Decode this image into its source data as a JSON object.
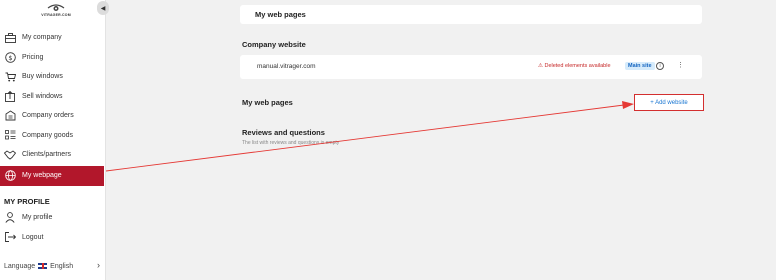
{
  "sidebar": {
    "logo_text": "VITRAGER.COM",
    "items": [
      {
        "label": "My company",
        "icon": "briefcase-icon"
      },
      {
        "label": "Pricing",
        "icon": "dollar-icon"
      },
      {
        "label": "Buy windows",
        "icon": "cart-icon"
      },
      {
        "label": "Sell windows",
        "icon": "upload-icon"
      },
      {
        "label": "Company orders",
        "icon": "clipboard-icon"
      },
      {
        "label": "Company goods",
        "icon": "list-icon"
      },
      {
        "label": "Clients/partners",
        "icon": "handshake-icon"
      },
      {
        "label": "My webpage",
        "icon": "globe-icon",
        "active": true
      }
    ],
    "profile_section_title": "MY PROFILE",
    "profile_items": [
      {
        "label": "My profile",
        "icon": "user-icon"
      },
      {
        "label": "Logout",
        "icon": "logout-icon"
      }
    ],
    "language_label": "Language",
    "language_value": "English"
  },
  "main": {
    "header_title": "My web pages",
    "company_section_title": "Company website",
    "site": {
      "url": "manual.vitrager.com",
      "warning": "Deleted elements available",
      "badge": "Main site"
    },
    "webpages_title": "My web pages",
    "add_button_label": "+ Add website",
    "reviews_title": "Reviews and questions",
    "reviews_empty": "The list with reviews and questions is empty"
  },
  "colors": {
    "accent": "#b2172b",
    "link": "#1976d2",
    "warning": "#c62828",
    "annotation": "#d32f2f"
  }
}
